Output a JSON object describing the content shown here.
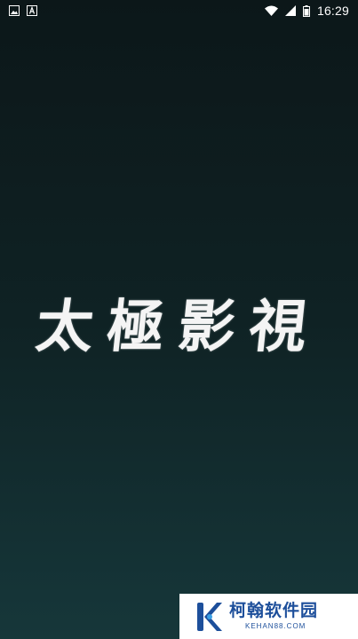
{
  "status_bar": {
    "time": "16:29",
    "left_icons": [
      "image-icon",
      "text-icon"
    ],
    "right_icons": [
      "wifi-icon",
      "signal-icon",
      "battery-icon"
    ]
  },
  "splash": {
    "title": "太極影視"
  },
  "watermark": {
    "name": "柯翰软件园",
    "url": "KEHAN88.COM",
    "color": "#1d4f9b",
    "icon": "k-logo-icon"
  },
  "colors": {
    "background_top": "#0c1719",
    "background_bottom": "#16373a",
    "title": "#f4f4f4"
  }
}
